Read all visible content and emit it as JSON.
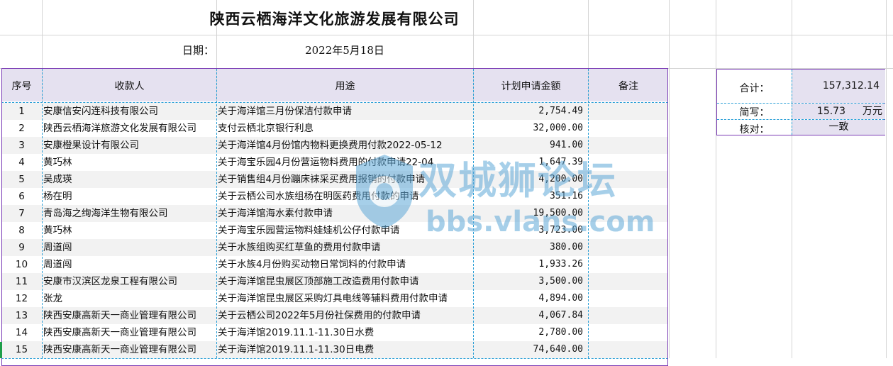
{
  "title": "陕西云栖海洋文化旅游发展有限公司",
  "date": {
    "label": "日期：",
    "value": "2022年5月18日"
  },
  "headers": {
    "seq": "序号",
    "payee": "收款人",
    "purpose": "用途",
    "amount": "计划申请金额",
    "note": "备注"
  },
  "rows": [
    {
      "seq": "1",
      "payee": "安康信安闪连科技有限公司",
      "purpose": "关于海洋馆三月份保洁付款申请",
      "amount": "2,754.49"
    },
    {
      "seq": "2",
      "payee": "陕西云栖海洋旅游文化发展有限公司",
      "purpose": "支付云栖北京银行利息",
      "amount": "32,000.00"
    },
    {
      "seq": "3",
      "payee": "安康橙果设计有限公司",
      "purpose": "关于海洋馆4月份馆内物料更换费用付款2022-05-12",
      "amount": "941.00"
    },
    {
      "seq": "4",
      "payee": "黄巧林",
      "purpose": "关于海宝乐园4月份营运物料费用的付款申请22-04",
      "amount": "1,647.39"
    },
    {
      "seq": "5",
      "payee": "吴成瑛",
      "purpose": "关于销售组4月份蹦床袜采买费用报销的付款申请",
      "amount": "4,200.00"
    },
    {
      "seq": "6",
      "payee": "杨在明",
      "purpose": "关于云栖公司水族组杨在明医药费用付款的申请",
      "amount": "351.16"
    },
    {
      "seq": "7",
      "payee": "青岛海之绚海洋生物有限公司",
      "purpose": "关于海洋馆海水素付款申请",
      "amount": "19,500.00"
    },
    {
      "seq": "8",
      "payee": "黄巧林",
      "purpose": "关于海宝乐园营运物料娃娃机公仔付款申请",
      "amount": "3,723.00"
    },
    {
      "seq": "9",
      "payee": "周道闯",
      "purpose": "关于水族组购买红草鱼的费用付款申请",
      "amount": "380.00"
    },
    {
      "seq": "10",
      "payee": "周道闯",
      "purpose": "关于水族4月份购买动物日常饲料的付款申请",
      "amount": "1,933.26"
    },
    {
      "seq": "11",
      "payee": "安康市汉滨区龙泉工程有限公司",
      "purpose": "关于海洋馆昆虫展区顶部施工改造费用付款申请",
      "amount": "3,500.00"
    },
    {
      "seq": "12",
      "payee": "张龙",
      "purpose": "关于海洋馆昆虫展区采购灯具电线等辅料费用付款申请",
      "amount": "4,894.00"
    },
    {
      "seq": "13",
      "payee": "陕西安康高新天一商业管理有限公司",
      "purpose": "关于云栖公司2022年5月份社保费用的付款申请",
      "amount": "4,067.84"
    },
    {
      "seq": "14",
      "payee": "陕西安康高新天一商业管理有限公司",
      "purpose": "关于海洋馆2019.11.1-11.30日水费",
      "amount": "2,780.00"
    },
    {
      "seq": "15",
      "payee": "陕西安康高新天一商业管理有限公司",
      "purpose": "关于海洋馆2019.11.1-11.30日电费",
      "amount": "74,640.00"
    }
  ],
  "summary": {
    "total_label": "合计：",
    "total_value": "157,312.14",
    "short_label": "简写：",
    "short_value": "15.73",
    "short_unit": "万元",
    "check_label": "核对：",
    "check_value": "一致"
  },
  "watermark": {
    "cn": "双城狮论坛",
    "url": "bbs.vlans.com"
  }
}
